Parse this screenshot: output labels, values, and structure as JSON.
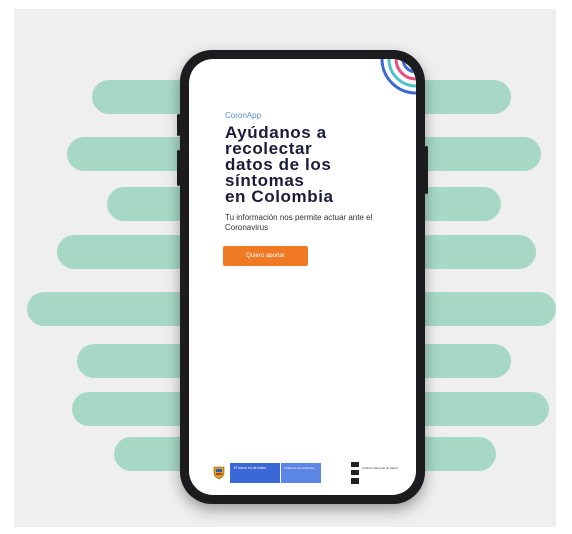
{
  "app": {
    "name": "CoronApp",
    "headline": [
      "Ayúdanos a",
      "recolectar",
      "datos de los",
      "síntomas",
      "en Colombia"
    ],
    "subtitle": "Tu información nos permite actuar ante el Coronavirus",
    "cta_label": "Quiero aportar"
  },
  "footer": {
    "gov_logo_text": "El futuro es de todos",
    "ministry_text": "Gobierno de Colombia",
    "institute_text": "Instituto Nacional de Salud"
  },
  "colors": {
    "background": "#efefef",
    "stripes": "#a7d8c6",
    "accent": "#f07a23",
    "headline": "#1b1b3a",
    "app_name": "#5a8fd8",
    "gov_blue": "#3a68d6"
  },
  "icons": {
    "corner": "concentric-circles-icon",
    "shield": "colombia-shield-icon",
    "institute": "ins-logo-icon"
  }
}
